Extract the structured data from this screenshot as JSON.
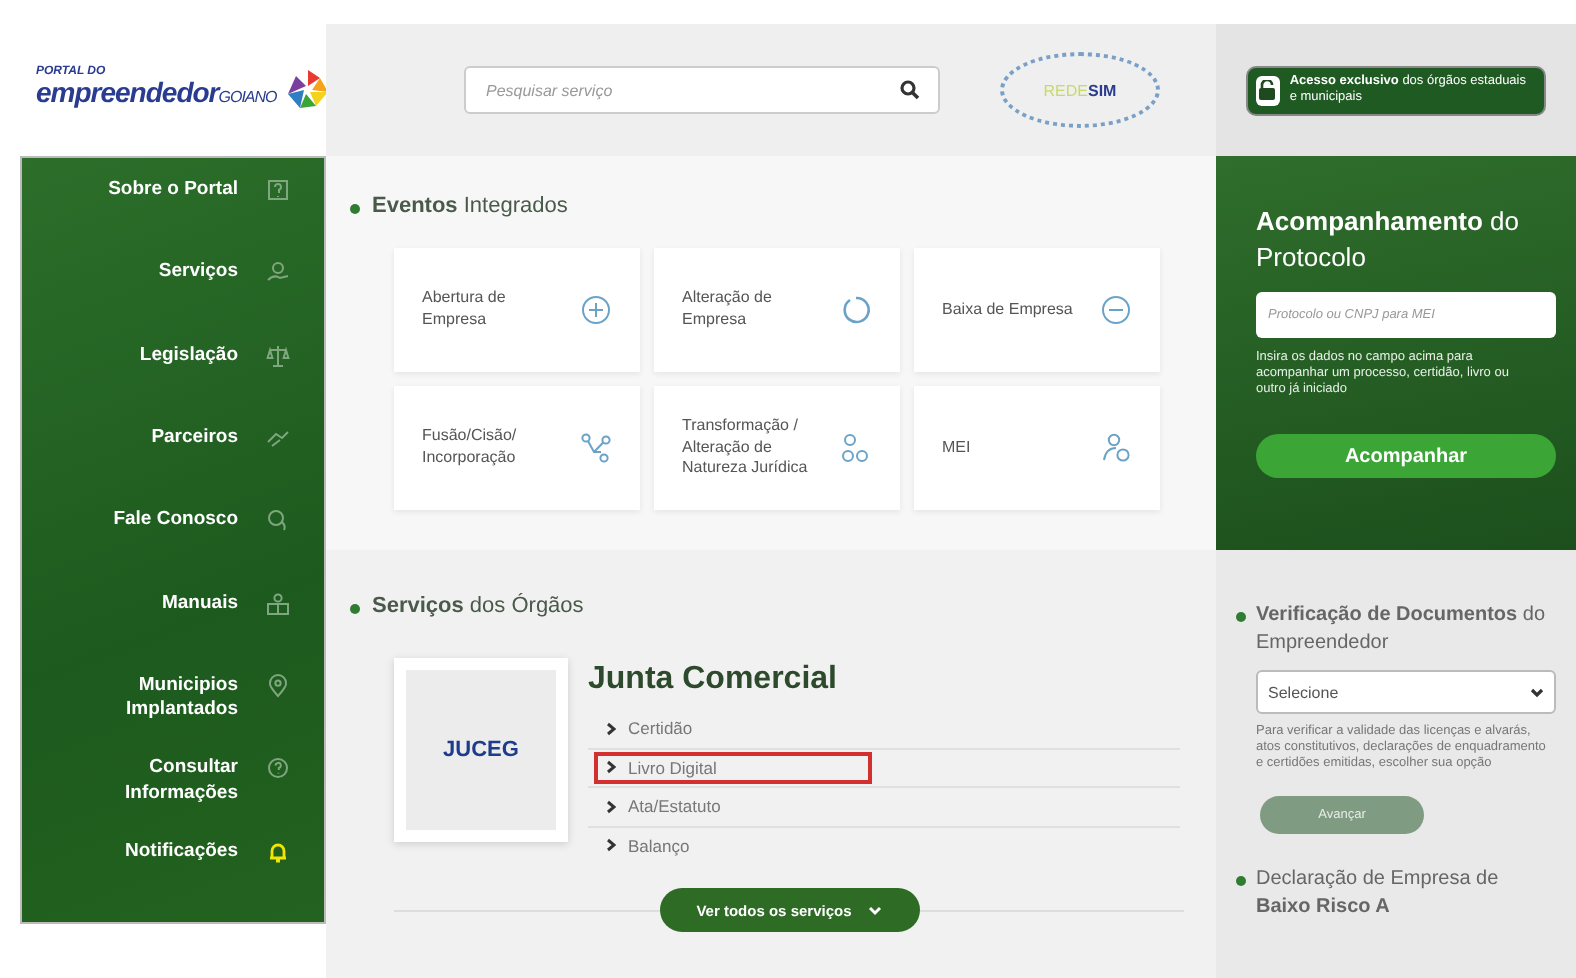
{
  "header": {
    "logo": {
      "top": "PORTAL DO",
      "main": "empreendedor",
      "suffix": "GOIANO"
    },
    "search": {
      "placeholder": "Pesquisar serviço"
    },
    "partner_logo": {
      "text_a": "REDE",
      "text_b": "SIM"
    },
    "access_button": {
      "text": "**Acesso exclusivo** dos órgãos estaduais e municipais"
    }
  },
  "sidebar": {
    "items": [
      {
        "label": "Sobre o Portal",
        "attention": false
      },
      {
        "label": "Serviços",
        "attention": false
      },
      {
        "label": "Legislação",
        "attention": false
      },
      {
        "label": "Parceiros",
        "attention": false
      },
      {
        "label": "Fale Conosco",
        "attention": false
      },
      {
        "label": "Manuais",
        "attention": false
      },
      {
        "label": "Municipios Implantados",
        "attention": false
      },
      {
        "label": "Consultar Informações",
        "attention": false
      },
      {
        "label": "Notificações",
        "attention": true
      }
    ]
  },
  "events": {
    "title": "**Eventos** Integrados",
    "cards": [
      {
        "label": "Abertura de Empresa"
      },
      {
        "label": "Alteração de Empresa"
      },
      {
        "label": "Baixa de Empresa"
      },
      {
        "label": "Fusão/Cisão/ Incorporação"
      },
      {
        "label": "Transformação / Alteração de Natureza Jurídica"
      },
      {
        "label": "MEI"
      }
    ]
  },
  "services": {
    "title": "**Serviços** dos Órgãos",
    "organ": {
      "logo_text": "JUCEG",
      "name": "Junta Comercial",
      "links": [
        {
          "label": "Certidão",
          "highlighted": false
        },
        {
          "label": "Livro Digital",
          "highlighted": true
        },
        {
          "label": "Ata/Estatuto",
          "highlighted": false
        },
        {
          "label": "Balanço",
          "highlighted": false
        }
      ]
    },
    "more_button": "Ver todos os serviços"
  },
  "protocol": {
    "title": "**Acompanhamento** do Protocolo",
    "input": {
      "placeholder": "Protocolo ou CNPJ para MEI"
    },
    "help": "Insira os dados no campo acima para acompanhar um processo, certidão, livro ou outro já iniciado",
    "button": "Acompanhar"
  },
  "verification": {
    "title": "**Verificação de Documentos** do Empreendedor",
    "select": {
      "value": "Selecione"
    },
    "help": "Para verificar a validade das licenças e alvarás, atos constitutivos, declarações de enquadramento e certidões emitidas, escolher sua opção",
    "button": {
      "label": "Avançar",
      "disabled": true
    }
  },
  "declaration": {
    "title": "Declaração de Empresa de **Baixo Risco A**"
  }
}
